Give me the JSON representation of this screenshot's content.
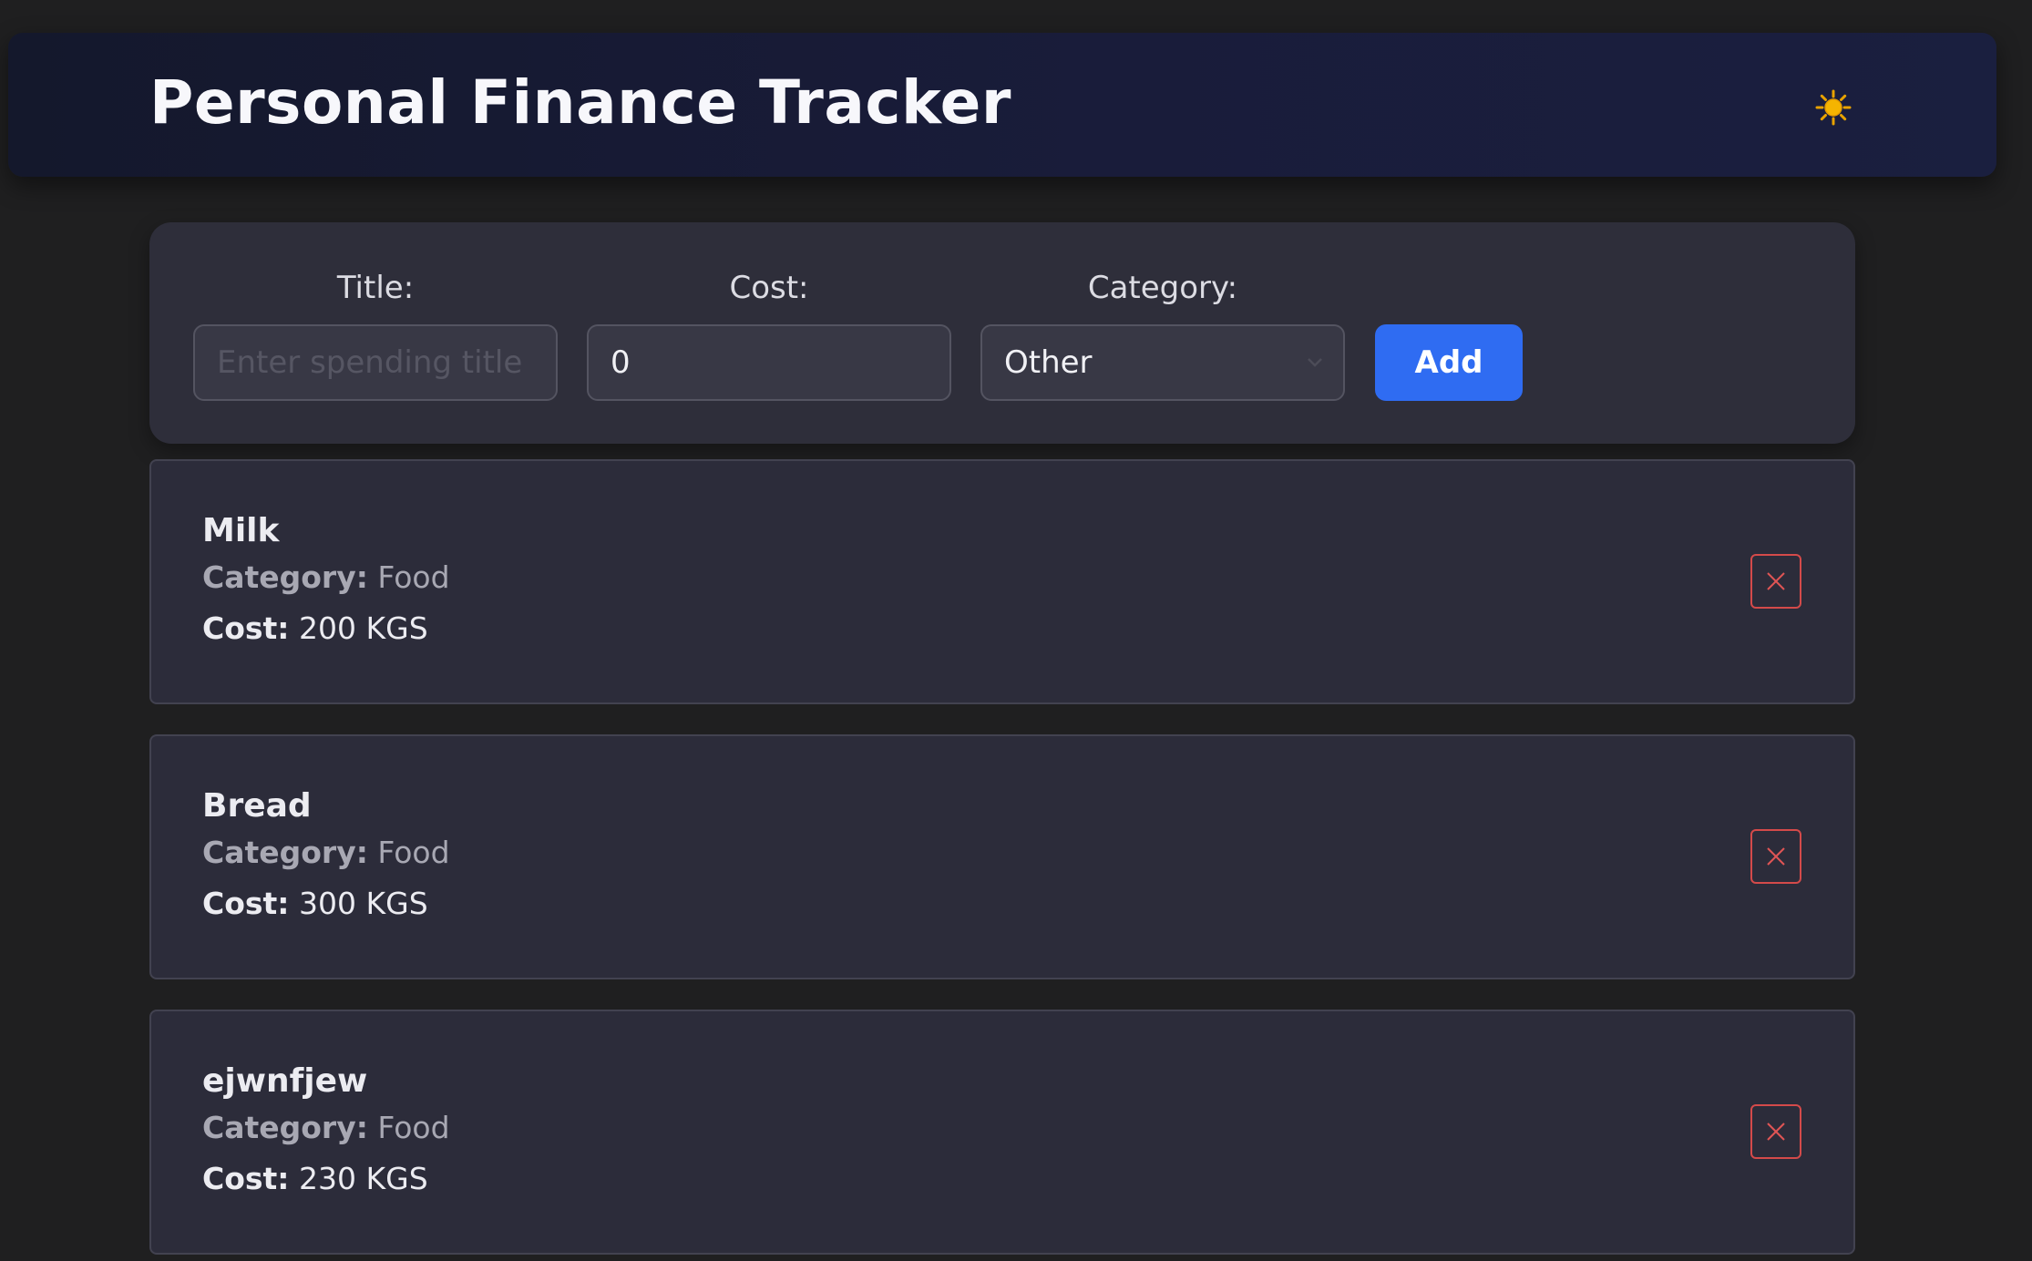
{
  "app": {
    "title": "Personal Finance Tracker",
    "theme_toggle_icon": "sun-icon"
  },
  "form": {
    "title_label": "Title:",
    "title_placeholder": "Enter spending title",
    "title_value": "",
    "cost_label": "Cost:",
    "cost_value": "0",
    "category_label": "Category:",
    "category_value": "Other",
    "add_label": "Add"
  },
  "labels": {
    "category": "Category:",
    "cost": "Cost:"
  },
  "expenses": [
    {
      "title": "Milk",
      "category": "Food",
      "cost": "200 KGS"
    },
    {
      "title": "Bread",
      "category": "Food",
      "cost": "300 KGS"
    },
    {
      "title": "ejwnfjew",
      "category": "Food",
      "cost": "230 KGS"
    }
  ],
  "colors": {
    "accent": "#2f6cf2",
    "delete": "#d44a4a",
    "sun": "#f5b400"
  }
}
